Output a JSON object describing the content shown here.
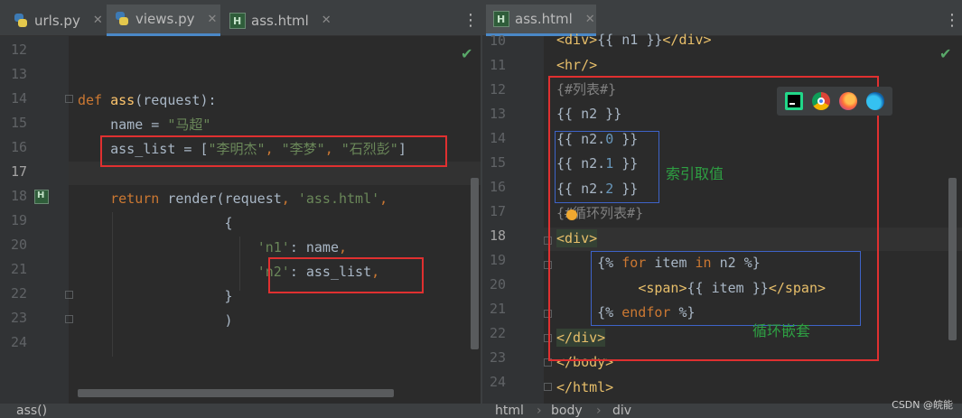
{
  "left_pane": {
    "tabs": [
      {
        "label": "urls.py",
        "icon": "python-file-icon",
        "active": false
      },
      {
        "label": "views.py",
        "icon": "python-file-icon",
        "active": true
      },
      {
        "label": "ass.html",
        "icon": "html-file-icon",
        "active": false
      }
    ],
    "line_numbers": [
      "12",
      "13",
      "14",
      "15",
      "16",
      "17",
      "18",
      "19",
      "20",
      "21",
      "22",
      "23",
      "24"
    ],
    "current_line": "17",
    "breadcrumb": "ass()"
  },
  "right_pane": {
    "tabs": [
      {
        "label": "ass.html",
        "icon": "html-file-icon",
        "active": true
      }
    ],
    "line_numbers": [
      "10",
      "11",
      "12",
      "13",
      "14",
      "15",
      "16",
      "17",
      "18",
      "19",
      "20",
      "21",
      "22",
      "23",
      "24"
    ],
    "current_line": "18",
    "breadcrumb": [
      "html",
      "body",
      "div"
    ]
  },
  "annotations": {
    "index_access": "索引取值",
    "loop_nesting": "循环嵌套"
  },
  "watermark": "CSDN @皖能",
  "colors": {
    "background": "#2b2b2b",
    "keyword": "#cc7832",
    "string": "#6a8759",
    "tag": "#e8bf6a",
    "red_box": "#e03030",
    "blue_box": "#3e63c8",
    "annotation": "#2ea043"
  },
  "browser_icons": [
    "pycharm-icon",
    "chrome-icon",
    "firefox-icon",
    "edge-icon"
  ]
}
